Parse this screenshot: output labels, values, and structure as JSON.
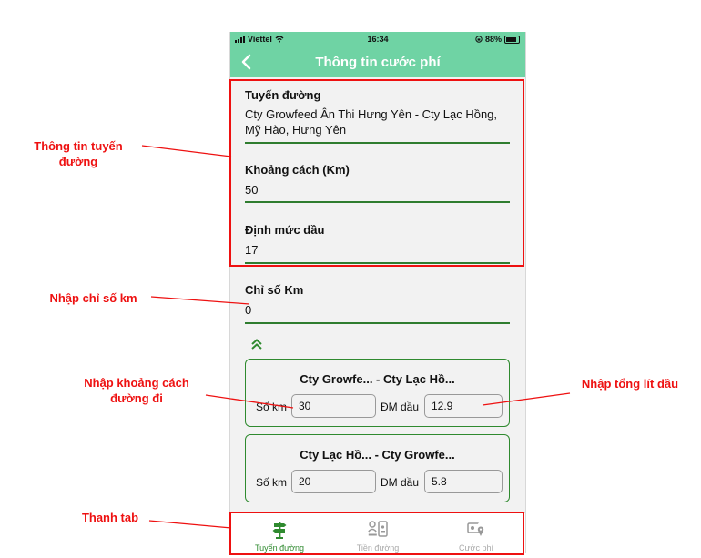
{
  "status": {
    "carrier": "Viettel",
    "time": "16:34",
    "battery": "88%"
  },
  "header": {
    "title": "Thông tin cước phí"
  },
  "route": {
    "label": "Tuyến đường",
    "value": " Cty Growfeed Ân Thi Hưng Yên -  Cty Lạc Hồng, Mỹ Hào, Hưng Yên"
  },
  "distance": {
    "label": "Khoảng cách (Km)",
    "value": "50"
  },
  "fuel_norm": {
    "label": "Định mức dầu",
    "value": "17"
  },
  "km_index": {
    "label": "Chỉ số Km",
    "value": "0"
  },
  "segments": [
    {
      "title": "Cty Growfe...  -  Cty Lạc Hồ...",
      "km_label": "Số km",
      "km_value": "30",
      "fuel_label": "ĐM dầu",
      "fuel_value": "12.9"
    },
    {
      "title": "Cty Lạc Hồ...  -  Cty Growfe...",
      "km_label": "Số km",
      "km_value": "20",
      "fuel_label": "ĐM dầu",
      "fuel_value": "5.8"
    }
  ],
  "tabs": [
    {
      "label": "Tuyến đường",
      "icon": "signpost-icon",
      "active": true
    },
    {
      "label": "Tiền đường",
      "icon": "toll-icon",
      "active": false
    },
    {
      "label": "Cước phí",
      "icon": "fare-location-icon",
      "active": false
    }
  ],
  "annotations": {
    "route_info": "Thông tin tuyến đường",
    "km_input": "Nhập chỉ số km",
    "distance_input": "Nhập khoảng cách đường đi",
    "fuel_input": "Nhập tổng lít dầu",
    "tab_bar": "Thanh tab"
  },
  "colors": {
    "header": "#6fd3a4",
    "accent": "#2f8a2f",
    "annotation": "#e11111"
  }
}
